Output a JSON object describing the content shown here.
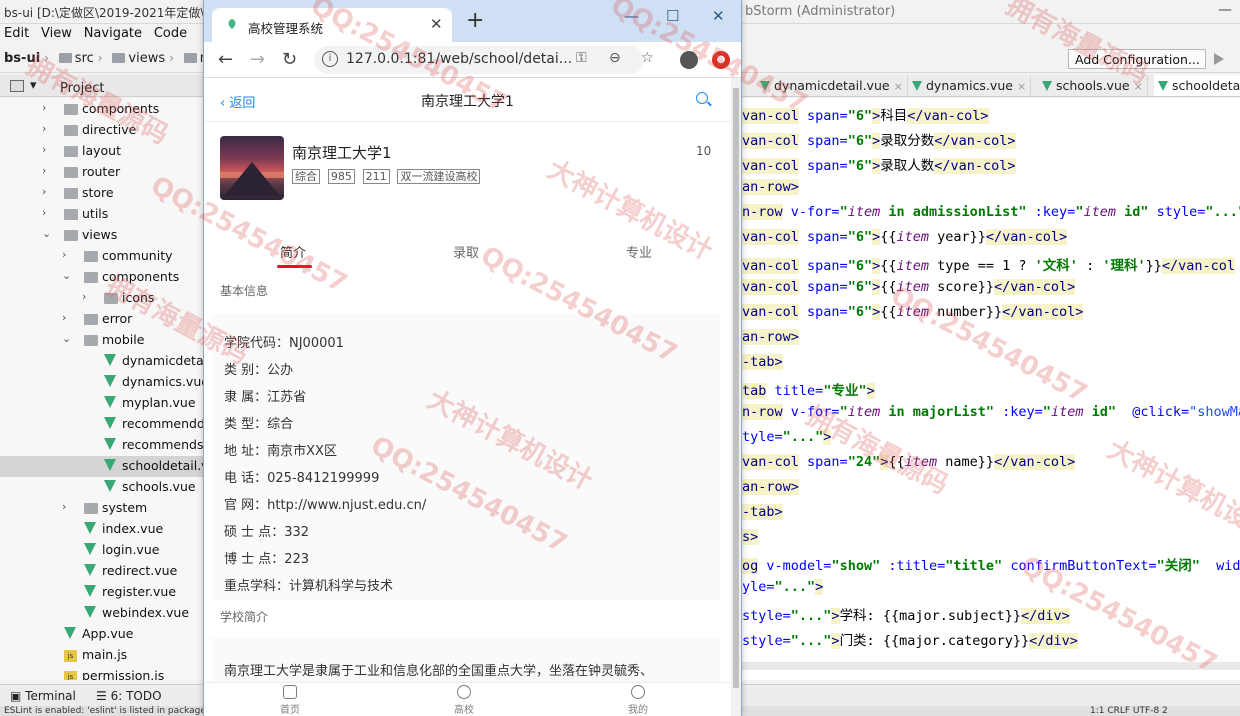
{
  "ide": {
    "title_left": "bs-ui [D:\\定做区\\2019-2021年定做\\",
    "title_right": "bStorm (Administrator)",
    "menu": [
      "Edit",
      "View",
      "Navigate",
      "Code",
      "R"
    ],
    "breadcrumb": [
      "bs-ui",
      "src",
      "views",
      "mo"
    ],
    "project_label": "Project",
    "tree": [
      {
        "label": "components",
        "indent": 0,
        "kind": "folder",
        "arrow": "›"
      },
      {
        "label": "directive",
        "indent": 0,
        "kind": "folder",
        "arrow": "›"
      },
      {
        "label": "layout",
        "indent": 0,
        "kind": "folder",
        "arrow": "›"
      },
      {
        "label": "router",
        "indent": 0,
        "kind": "folder",
        "arrow": "›"
      },
      {
        "label": "store",
        "indent": 0,
        "kind": "folder",
        "arrow": "›"
      },
      {
        "label": "utils",
        "indent": 0,
        "kind": "folder",
        "arrow": "›"
      },
      {
        "label": "views",
        "indent": 0,
        "kind": "folder",
        "arrow": "⌄"
      },
      {
        "label": "community",
        "indent": 1,
        "kind": "folder",
        "arrow": "›"
      },
      {
        "label": "components",
        "indent": 1,
        "kind": "folder",
        "arrow": "⌄"
      },
      {
        "label": "icons",
        "indent": 2,
        "kind": "folder",
        "arrow": "›"
      },
      {
        "label": "error",
        "indent": 1,
        "kind": "folder",
        "arrow": "›"
      },
      {
        "label": "mobile",
        "indent": 1,
        "kind": "folder",
        "arrow": "⌄"
      },
      {
        "label": "dynamicdetail.",
        "indent": 2,
        "kind": "vue",
        "arrow": ""
      },
      {
        "label": "dynamics.vue",
        "indent": 2,
        "kind": "vue",
        "arrow": ""
      },
      {
        "label": "myplan.vue",
        "indent": 2,
        "kind": "vue",
        "arrow": ""
      },
      {
        "label": "recommendde",
        "indent": 2,
        "kind": "vue",
        "arrow": ""
      },
      {
        "label": "recommends.v",
        "indent": 2,
        "kind": "vue",
        "arrow": ""
      },
      {
        "label": "schooldetail.vu",
        "indent": 2,
        "kind": "vue",
        "arrow": "",
        "selected": true
      },
      {
        "label": "schools.vue",
        "indent": 2,
        "kind": "vue",
        "arrow": ""
      },
      {
        "label": "system",
        "indent": 1,
        "kind": "folder",
        "arrow": "›"
      },
      {
        "label": "index.vue",
        "indent": 1,
        "kind": "vue",
        "arrow": ""
      },
      {
        "label": "login.vue",
        "indent": 1,
        "kind": "vue",
        "arrow": ""
      },
      {
        "label": "redirect.vue",
        "indent": 1,
        "kind": "vue",
        "arrow": ""
      },
      {
        "label": "register.vue",
        "indent": 1,
        "kind": "vue",
        "arrow": ""
      },
      {
        "label": "webindex.vue",
        "indent": 1,
        "kind": "vue",
        "arrow": ""
      },
      {
        "label": "App.vue",
        "indent": 0,
        "kind": "vue",
        "arrow": ""
      },
      {
        "label": "main.js",
        "indent": 0,
        "kind": "js",
        "arrow": ""
      },
      {
        "label": "permission.js",
        "indent": 0,
        "kind": "js",
        "arrow": ""
      }
    ],
    "add_configuration": "Add Configuration...",
    "editor_tabs": [
      {
        "label": "dynamicdetail.vue",
        "active": false
      },
      {
        "label": "dynamics.vue",
        "active": false
      },
      {
        "label": "schools.vue",
        "active": false
      },
      {
        "label": "schooldetail",
        "active": true
      }
    ],
    "bottom_terminal": "Terminal",
    "bottom_todo": "6: TODO",
    "status_text": "ESLint is enabled: 'eslint' is listed in package.json. Configure…",
    "status_right": "1:1  CRLF  UTF-8  2"
  },
  "code": [
    [
      [
        "tg",
        "van-col"
      ],
      [
        "t",
        " "
      ],
      [
        "at",
        "span="
      ],
      [
        "sv",
        "\"6\""
      ],
      [
        "tg",
        ">"
      ],
      [
        "t",
        "科目"
      ],
      [
        "tg",
        "</van-col>"
      ]
    ],
    [
      [
        "tg",
        "van-col"
      ],
      [
        "t",
        " "
      ],
      [
        "at",
        "span="
      ],
      [
        "sv",
        "\"6\""
      ],
      [
        "tg",
        ">"
      ],
      [
        "t",
        "录取分数"
      ],
      [
        "tg",
        "</van-col>"
      ]
    ],
    [
      [
        "tg",
        "van-col"
      ],
      [
        "t",
        " "
      ],
      [
        "at",
        "span="
      ],
      [
        "sv",
        "\"6\""
      ],
      [
        "tg",
        ">"
      ],
      [
        "t",
        "录取人数"
      ],
      [
        "tg",
        "</van-col>"
      ]
    ],
    [
      [
        "tg",
        "an-row>"
      ]
    ],
    [
      [
        "tg",
        "n-row"
      ],
      [
        "t",
        " "
      ],
      [
        "at",
        "v-for="
      ],
      [
        "sv",
        "\""
      ],
      [
        "it",
        "item"
      ],
      [
        "sv",
        " in admissionList\""
      ],
      [
        "t",
        " "
      ],
      [
        "at",
        ":key="
      ],
      [
        "sv",
        "\""
      ],
      [
        "it",
        "item"
      ],
      [
        "sv",
        " id\""
      ],
      [
        "t",
        " "
      ],
      [
        "at",
        "style="
      ],
      [
        "sv",
        "\"...\""
      ],
      [
        "tg",
        ">"
      ]
    ],
    [
      [
        "tg",
        "van-col"
      ],
      [
        "t",
        " "
      ],
      [
        "at",
        "span="
      ],
      [
        "sv",
        "\"6\""
      ],
      [
        "tg",
        ">"
      ],
      [
        "t",
        "{{"
      ],
      [
        "it",
        "item"
      ],
      [
        "t",
        " year}}"
      ],
      [
        "tg",
        "</van-col>"
      ]
    ],
    [
      [
        "tg",
        "van-col"
      ],
      [
        "t",
        " "
      ],
      [
        "at",
        "span="
      ],
      [
        "sv",
        "\"6\""
      ],
      [
        "tg",
        ">"
      ],
      [
        "t",
        "{{"
      ],
      [
        "it",
        "item"
      ],
      [
        "t",
        " type == 1 ? "
      ],
      [
        "sv",
        "'文科'"
      ],
      [
        "t",
        " : "
      ],
      [
        "sv",
        "'理科'"
      ],
      [
        "t",
        "}}"
      ],
      [
        "tg",
        "</van-col"
      ]
    ],
    [
      [
        "tg",
        "van-col"
      ],
      [
        "t",
        " "
      ],
      [
        "at",
        "span="
      ],
      [
        "sv",
        "\"6\""
      ],
      [
        "tg",
        ">"
      ],
      [
        "t",
        "{{"
      ],
      [
        "it",
        "item"
      ],
      [
        "t",
        " score}}"
      ],
      [
        "tg",
        "</van-col>"
      ]
    ],
    [
      [
        "tg",
        "van-col"
      ],
      [
        "t",
        " "
      ],
      [
        "at",
        "span="
      ],
      [
        "sv",
        "\"6\""
      ],
      [
        "tg",
        ">"
      ],
      [
        "t",
        "{{"
      ],
      [
        "it",
        "item"
      ],
      [
        "t",
        " number}}"
      ],
      [
        "tg",
        "</van-col>"
      ]
    ],
    [
      [
        "tg",
        "an-row>"
      ]
    ],
    [
      [
        "tg",
        "-tab>"
      ]
    ],
    [
      [
        "tg",
        "tab"
      ],
      [
        "t",
        " "
      ],
      [
        "at",
        "title="
      ],
      [
        "sv",
        "\"专业\""
      ],
      [
        "tg",
        ">"
      ]
    ],
    [
      [
        "tg",
        "n-row"
      ],
      [
        "t",
        " "
      ],
      [
        "at",
        "v-for="
      ],
      [
        "sv",
        "\""
      ],
      [
        "it",
        "item"
      ],
      [
        "sv",
        " in majorList\""
      ],
      [
        "t",
        " "
      ],
      [
        "at",
        ":key="
      ],
      [
        "sv",
        "\""
      ],
      [
        "it",
        "item"
      ],
      [
        "sv",
        " id\""
      ],
      [
        "t",
        "  "
      ],
      [
        "at",
        "@click="
      ],
      [
        "ev",
        "\"showMaj"
      ]
    ],
    [
      [
        "at",
        "tyle="
      ],
      [
        "sv",
        "\"...\""
      ],
      [
        "tg",
        ">"
      ]
    ],
    [
      [
        "tg",
        "van-col"
      ],
      [
        "t",
        " "
      ],
      [
        "at",
        "span="
      ],
      [
        "sv",
        "\"24\""
      ],
      [
        "tg",
        ">"
      ],
      [
        "t",
        "{{"
      ],
      [
        "it",
        "item"
      ],
      [
        "t",
        " name}}"
      ],
      [
        "tg",
        "</van-col>"
      ]
    ],
    [
      [
        "tg",
        "an-row>"
      ]
    ],
    [
      [
        "tg",
        "-tab>"
      ]
    ],
    [
      [
        "tg",
        "s>"
      ]
    ],
    [
      [
        "tg",
        "og"
      ],
      [
        "t",
        " "
      ],
      [
        "at",
        "v-model="
      ],
      [
        "sv",
        "\"show\""
      ],
      [
        "t",
        " "
      ],
      [
        "at",
        ":title="
      ],
      [
        "sv",
        "\"title\""
      ],
      [
        "t",
        " "
      ],
      [
        "at",
        "confirmButtonText="
      ],
      [
        "sv",
        "\"关闭\""
      ],
      [
        "t",
        "  "
      ],
      [
        "at",
        "widt"
      ]
    ],
    [
      [
        "at",
        "yle="
      ],
      [
        "sv",
        "\"...\""
      ],
      [
        "tg",
        ">"
      ]
    ],
    [
      [
        "at",
        "style="
      ],
      [
        "sv",
        "\"...\""
      ],
      [
        "tg",
        ">"
      ],
      [
        "t",
        "学科: {{major.subject}}"
      ],
      [
        "tg",
        "</div>"
      ]
    ],
    [
      [
        "at",
        "style="
      ],
      [
        "sv",
        "\"...\""
      ],
      [
        "tg",
        ">"
      ],
      [
        "t",
        "门类: {{major.category}}"
      ],
      [
        "tg",
        "</div>"
      ]
    ]
  ],
  "browser": {
    "tab_title": "高校管理系统",
    "url": "127.0.0.1:81/web/school/detai...",
    "new_tab_glyph": "+",
    "minimize_glyph": "—",
    "maximize_glyph": "☐",
    "close_glyph": "✕"
  },
  "page": {
    "back_label": "返回",
    "nav_title": "南京理工大学1",
    "school_name": "南京理工大学1",
    "tags": [
      "综合",
      "985",
      "211",
      "双一流建设高校"
    ],
    "count": "10",
    "tabs": [
      "简介",
      "录取",
      "专业"
    ],
    "basic_info_title": "基本信息",
    "info": [
      "学院代码：NJ00001",
      "类 别：公办",
      "隶 属：江苏省",
      "类 型：综合",
      "地 址：南京市XX区",
      "电 话：025-8412199999",
      "官 网：http://www.njust.edu.cn/",
      "硕 士 点：332",
      "博 士 点：223",
      "重点学科：计算机科学与技术"
    ],
    "intro_title": "学校简介",
    "intro_text": "南京理工大学是隶属于工业和信息化部的全国重点大学，坐落在钟灵毓秀、",
    "tabbar": [
      "首页",
      "高校",
      "我的"
    ]
  },
  "watermark": {
    "qq": "QQ:254540457",
    "slogan": "大神计算机设计",
    "slogan2": "拥有海量源码"
  },
  "colors": {
    "accent_red": "#ee0a24",
    "link_blue": "#1989fa",
    "vue_green": "#3aa776"
  }
}
